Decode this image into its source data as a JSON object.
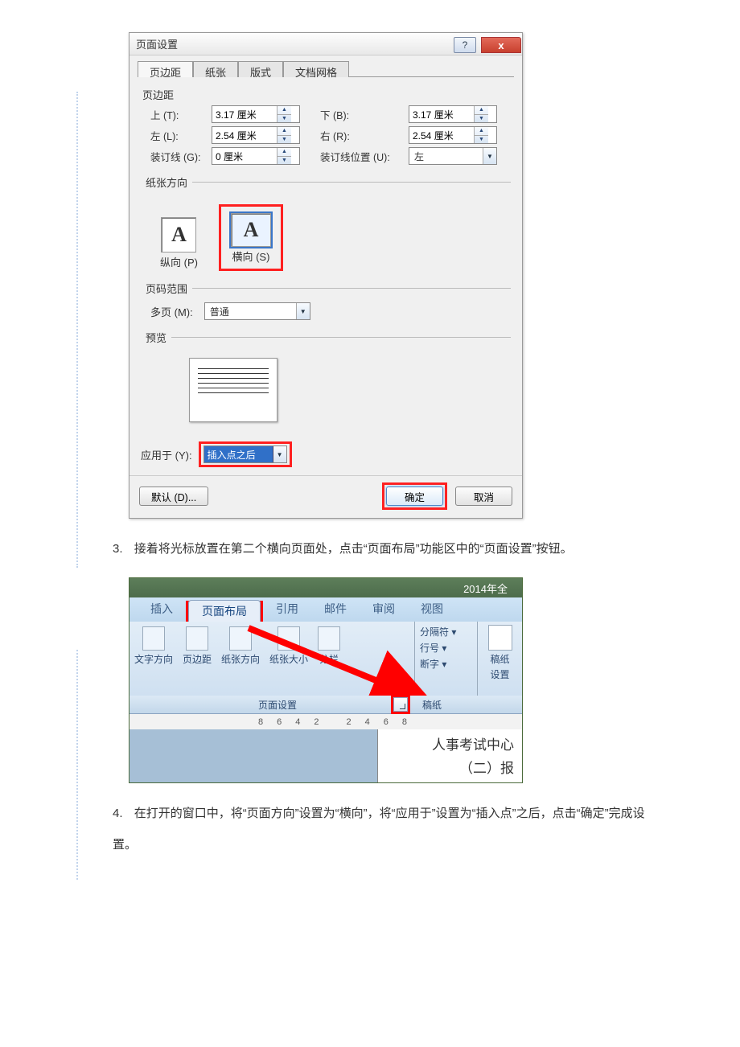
{
  "dialog": {
    "title": "页面设置",
    "help": "?",
    "close": "x",
    "tabs": [
      "页边距",
      "纸张",
      "版式",
      "文档网格"
    ],
    "section_margin": "页边距",
    "top_label": "上 (T):",
    "top_value": "3.17 厘米",
    "bottom_label": "下 (B):",
    "bottom_value": "3.17 厘米",
    "left_label": "左 (L):",
    "left_value": "2.54 厘米",
    "right_label": "右 (R):",
    "right_value": "2.54 厘米",
    "gutter_label": "装订线 (G):",
    "gutter_value": "0 厘米",
    "gutter_pos_label": "装订线位置 (U):",
    "gutter_pos_value": "左",
    "section_orientation": "纸张方向",
    "orient_portrait": "纵向 (P)",
    "orient_landscape": "横向 (S)",
    "section_pages": "页码范围",
    "multi_label": "多页 (M):",
    "multi_value": "普通",
    "section_preview": "预览",
    "apply_label": "应用于 (Y):",
    "apply_value": "插入点之后",
    "btn_default": "默认 (D)...",
    "btn_ok": "确定",
    "btn_cancel": "取消"
  },
  "step3": {
    "num": "3.",
    "text": "接着将光标放置在第二个横向页面处，点击“页面布局”功能区中的“页面设置”按钮。"
  },
  "ribbon": {
    "title_right": "2014年全",
    "tabs": {
      "insert": "插入",
      "layout": "页面布局",
      "ref": "引用",
      "mail": "邮件",
      "review": "审阅",
      "view": "视图"
    },
    "items": {
      "textdir": "文字方向",
      "margin": "页边距",
      "orient": "纸张方向",
      "size": "纸张大小",
      "cols": "分栏"
    },
    "side": {
      "breaks": "分隔符 ▾",
      "lineno": "行号 ▾",
      "hyphen": "断字 ▾"
    },
    "side2": {
      "label1": "稿纸",
      "label2": "设置"
    },
    "foot_label1": "页面设置",
    "foot_label2": "稿纸",
    "ruler": [
      "8",
      "6",
      "4",
      "2",
      "",
      "2",
      "4",
      "6",
      "8"
    ],
    "doc_line1": "人事考试中心",
    "doc_line2": "（二）报"
  },
  "step4": {
    "num": "4.",
    "text": "在打开的窗口中，将“页面方向”设置为“横向”，将“应用于”设置为“插入点”之后，点击“确定”完成设置。"
  }
}
